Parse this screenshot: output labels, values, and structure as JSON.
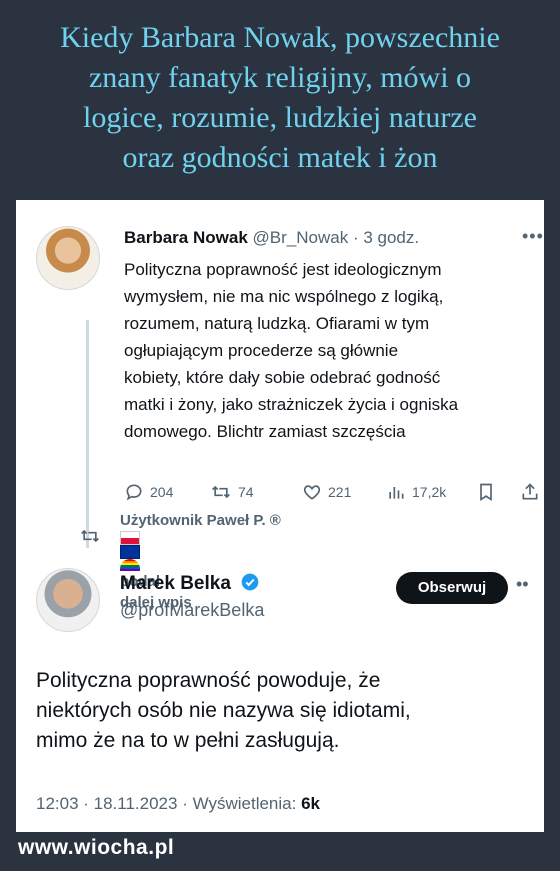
{
  "header": {
    "lines": [
      "Kiedy Barbara Nowak, powszechnie",
      "znany fanatyk religijny, mówi o",
      "logice, rozumie, ludzkiej naturze",
      "oraz godności matek i żon"
    ]
  },
  "tweet1": {
    "author_name": "Barbara Nowak",
    "handle": "@Br_Nowak",
    "time": "· 3 godz.",
    "more_icon": "more-icon",
    "body_lines": [
      "Polityczna poprawność jest ideologicznym",
      "wymysłem, nie ma nic wspólnego z logiką,",
      "rozumem, naturą ludzką. Ofiarami w tym",
      "ogłupiającym procederze są głównie",
      "kobiety, które dały sobie odebrać godność",
      "matki i żony, jako strażniczek życia i ogniska",
      "domowego. Blichtr zamiast szczęścia"
    ],
    "stats": {
      "replies": "204",
      "retweets": "74",
      "likes": "221",
      "views": "17,2k"
    }
  },
  "retweet_notice": {
    "line1": "Użytkownik Paweł P. ®",
    "line1_suffix": "podał",
    "line2": "dalej wpis"
  },
  "tweet2": {
    "author_name": "Marek Belka",
    "handle": "@profMarekBelka",
    "follow_label": "Obserwuj",
    "body_lines": [
      "Polityczna poprawność powoduje, że",
      "niektórych osób nie nazywa się idiotami,",
      "mimo że na to w pełni zasługują."
    ],
    "meta_prefix": "12:03 · 18.11.2023 · Wyświetlenia:",
    "views": "6k"
  },
  "watermark": "www.wiocha.pl",
  "colors": {
    "background": "#2b3340",
    "title": "#6fd3f0",
    "verified": "#1d9bf0"
  }
}
